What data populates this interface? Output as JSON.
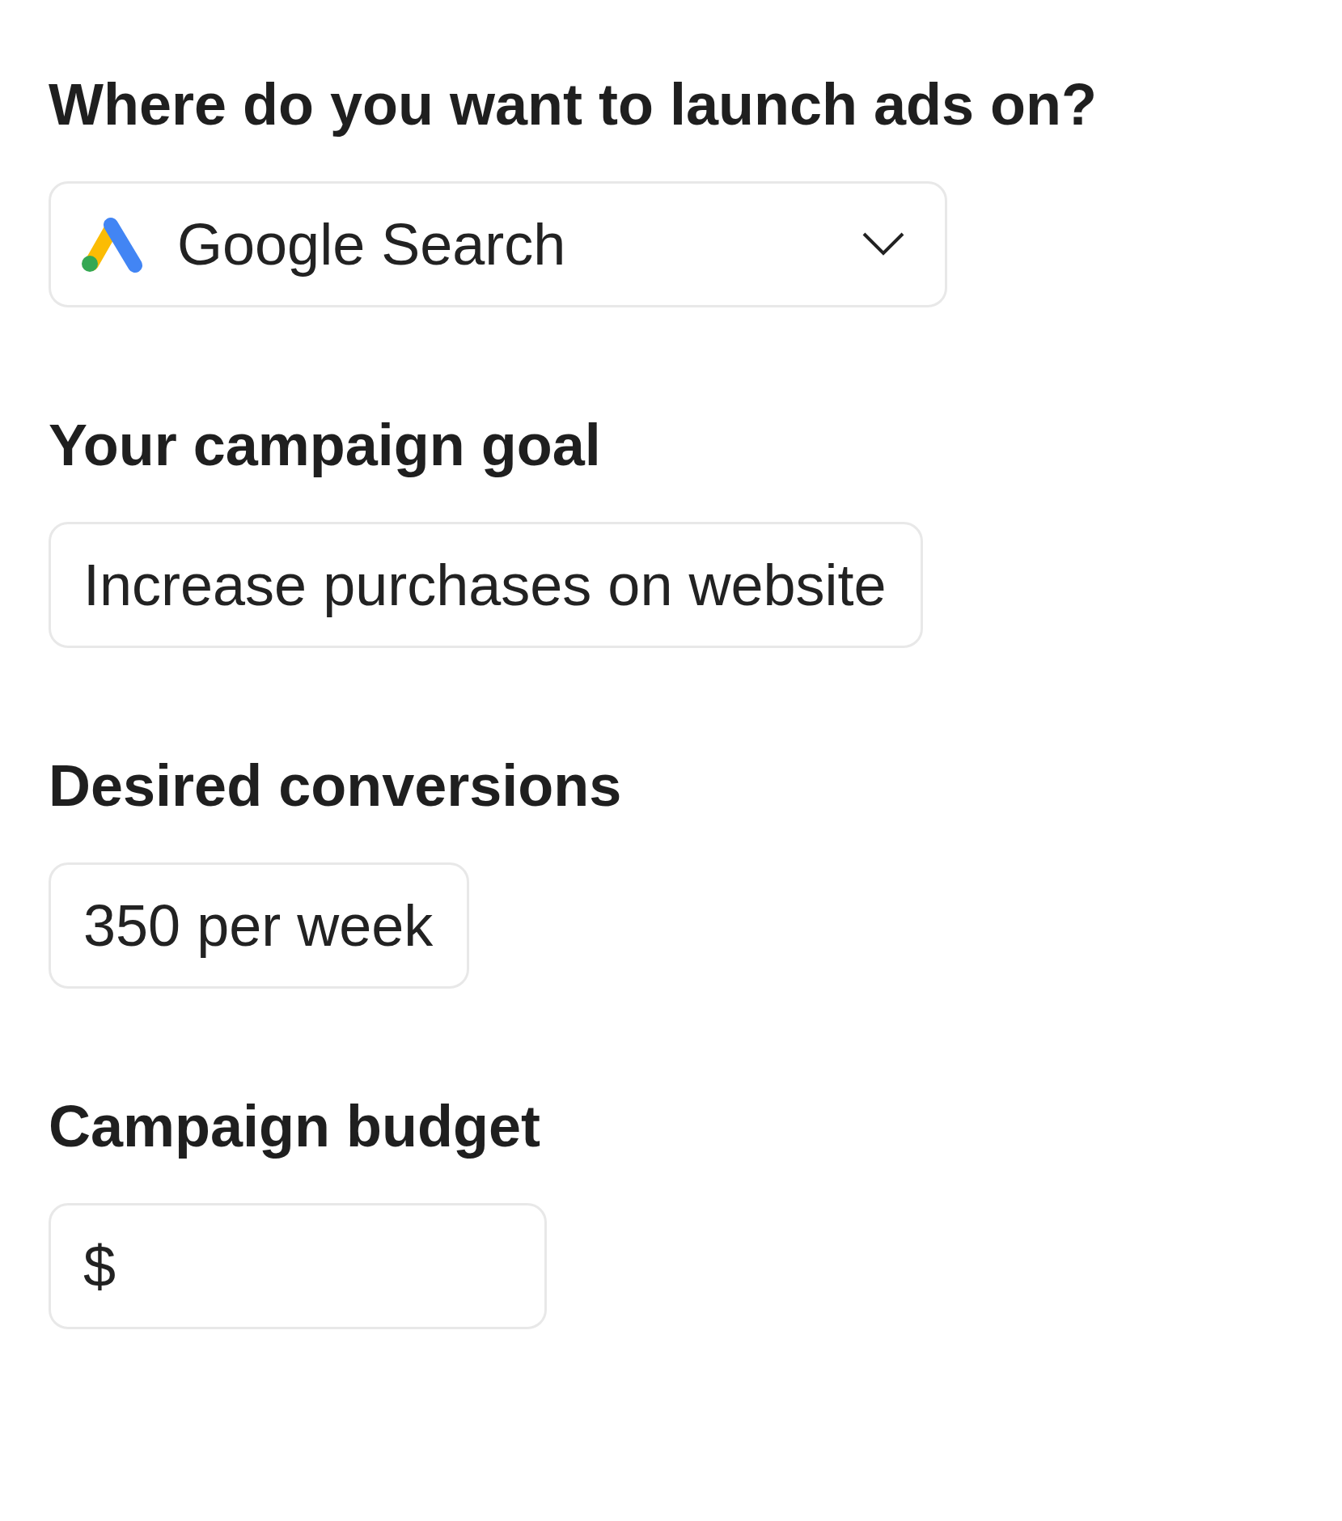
{
  "sections": [
    {
      "label": "Where do you want to launch ads on?",
      "field": {
        "kind": "select",
        "value": "Google Search"
      }
    },
    {
      "label": "Your campaign goal",
      "field": {
        "kind": "text",
        "value": "Increase purchases on website"
      }
    },
    {
      "label": "Desired conversions",
      "field": {
        "kind": "text",
        "value": "350 per week"
      }
    },
    {
      "label": "Campaign budget",
      "field": {
        "kind": "currency",
        "prefix": "$"
      }
    }
  ]
}
